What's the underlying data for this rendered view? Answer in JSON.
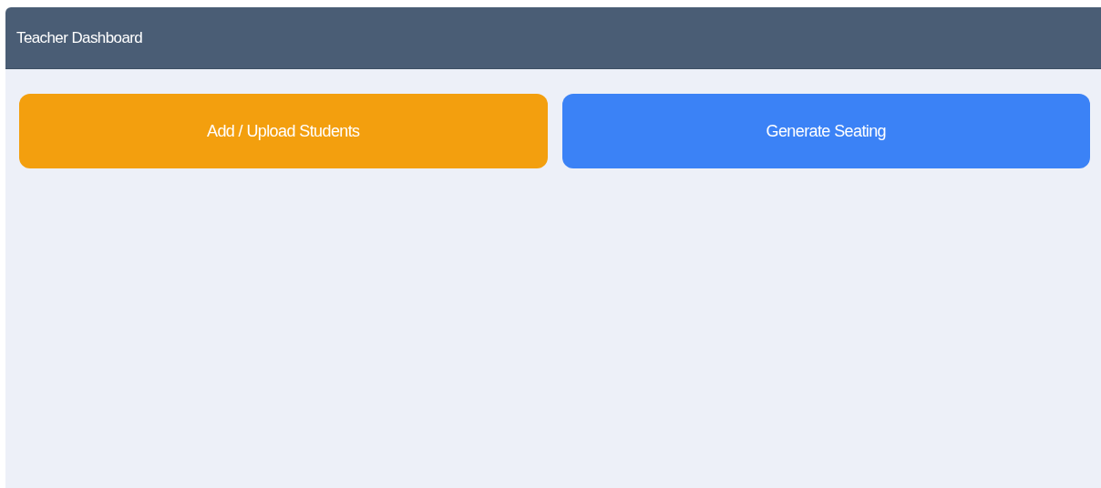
{
  "header": {
    "title": "Teacher Dashboard"
  },
  "actions": [
    {
      "label": "Add / Upload Students",
      "color": "#f39f0e"
    },
    {
      "label": "Generate Seating",
      "color": "#3b82f6"
    }
  ]
}
